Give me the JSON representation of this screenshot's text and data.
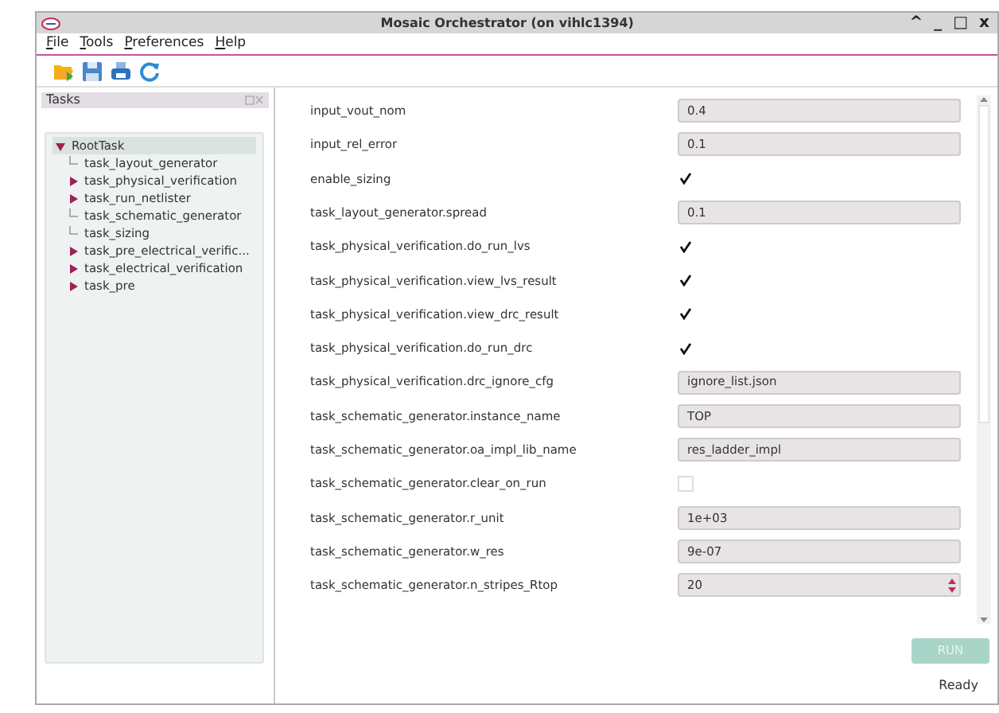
{
  "window": {
    "title": "Mosaic Orchestrator (on vihlc1394)",
    "controls": [
      "^",
      "_",
      "□",
      "x"
    ]
  },
  "menu": [
    {
      "label": "File"
    },
    {
      "label": "Tools"
    },
    {
      "label": "Preferences"
    },
    {
      "label": "Help"
    }
  ],
  "tasks_panel": {
    "title": "Tasks",
    "tree": [
      {
        "label": "RootTask",
        "kind": "branch",
        "expanded": true,
        "selected": true,
        "children": [
          {
            "label": "task_layout_generator",
            "kind": "leaf",
            "expanded": false,
            "selected": false
          },
          {
            "label": "task_physical_verification",
            "kind": "branch",
            "expanded": false,
            "selected": false
          },
          {
            "label": "task_run_netlister",
            "kind": "branch",
            "expanded": false,
            "selected": false
          },
          {
            "label": "task_schematic_generator",
            "kind": "leaf",
            "expanded": false,
            "selected": false
          },
          {
            "label": "task_sizing",
            "kind": "leaf",
            "expanded": false,
            "selected": false
          },
          {
            "label": "task_pre_electrical_verific...",
            "kind": "branch",
            "expanded": false,
            "selected": false
          },
          {
            "label": "task_electrical_verification",
            "kind": "branch",
            "expanded": false,
            "selected": false
          },
          {
            "label": "task_pre",
            "kind": "branch",
            "expanded": false,
            "selected": false
          }
        ]
      }
    ]
  },
  "parameters": [
    {
      "name": "input_vout_nom",
      "kind": "text",
      "value": "0.4"
    },
    {
      "name": "input_rel_error",
      "kind": "text",
      "value": "0.1"
    },
    {
      "name": "enable_sizing",
      "kind": "checkbox",
      "checked": true
    },
    {
      "name": "task_layout_generator.spread",
      "kind": "text",
      "value": "0.1"
    },
    {
      "name": "task_physical_verification.do_run_lvs",
      "kind": "checkbox",
      "checked": true
    },
    {
      "name": "task_physical_verification.view_lvs_result",
      "kind": "checkbox",
      "checked": true
    },
    {
      "name": "task_physical_verification.view_drc_result",
      "kind": "checkbox",
      "checked": true
    },
    {
      "name": "task_physical_verification.do_run_drc",
      "kind": "checkbox",
      "checked": true
    },
    {
      "name": "task_physical_verification.drc_ignore_cfg",
      "kind": "text",
      "value": "ignore_list.json"
    },
    {
      "name": "task_schematic_generator.instance_name",
      "kind": "text",
      "value": "TOP"
    },
    {
      "name": "task_schematic_generator.oa_impl_lib_name",
      "kind": "text",
      "value": "res_ladder_impl"
    },
    {
      "name": "task_schematic_generator.clear_on_run",
      "kind": "checkbox",
      "checked": false
    },
    {
      "name": "task_schematic_generator.r_unit",
      "kind": "text",
      "value": "1e+03"
    },
    {
      "name": "task_schematic_generator.w_res",
      "kind": "text",
      "value": "9e-07"
    },
    {
      "name": "task_schematic_generator.n_stripes_Rtop",
      "kind": "spin",
      "value": "20"
    }
  ],
  "run_button": {
    "label": "RUN",
    "disabled": true
  },
  "status_bar": {
    "text": "Ready"
  }
}
